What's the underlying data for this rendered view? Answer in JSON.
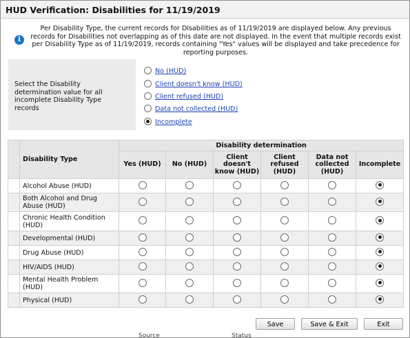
{
  "dialog": {
    "title": "HUD Verification: Disabilities for 11/19/2019",
    "info_text": "Per Disability Type, the current records for Disabilities as of 11/19/2019 are displayed below. Any previous records for Disabilities not overlapping as of this date are not displayed. In the event that multiple records exist per Disability Type as of 11/19/2019, records containing \"Yes\" values will be displayed and take precedence for reporting purposes."
  },
  "bulk_select": {
    "label": "Select the Disability determination value for all incomplete Disability Type records",
    "options": [
      "No (HUD)",
      "Client doesn't know (HUD)",
      "Client refused (HUD)",
      "Data not collected (HUD)",
      "Incomplete"
    ],
    "selected": "Incomplete"
  },
  "table": {
    "col_disability_type": "Disability Type",
    "group_header": "Disability determination",
    "columns": [
      "Yes (HUD)",
      "No (HUD)",
      "Client doesn't know (HUD)",
      "Client refused (HUD)",
      "Data not collected (HUD)",
      "Incomplete"
    ],
    "rows": [
      {
        "label": "Alcohol Abuse (HUD)",
        "selected": "Incomplete"
      },
      {
        "label": "Both Alcohol and Drug Abuse (HUD)",
        "selected": "Incomplete"
      },
      {
        "label": "Chronic Health Condition (HUD)",
        "selected": "Incomplete"
      },
      {
        "label": "Developmental (HUD)",
        "selected": "Incomplete"
      },
      {
        "label": "Drug Abuse (HUD)",
        "selected": "Incomplete"
      },
      {
        "label": "HIV/AIDS (HUD)",
        "selected": "Incomplete"
      },
      {
        "label": "Mental Health Problem (HUD)",
        "selected": "Incomplete"
      },
      {
        "label": "Physical (HUD)",
        "selected": "Incomplete"
      }
    ]
  },
  "buttons": {
    "save": "Save",
    "save_exit": "Save & Exit",
    "exit": "Exit"
  },
  "background_peek": {
    "left": "Source",
    "right": "Status"
  },
  "icons": {
    "info": "info-icon"
  },
  "colors": {
    "link": "#1a3fb5",
    "info_icon": "#1f73c8",
    "header_bg": "#e6e6e6"
  }
}
